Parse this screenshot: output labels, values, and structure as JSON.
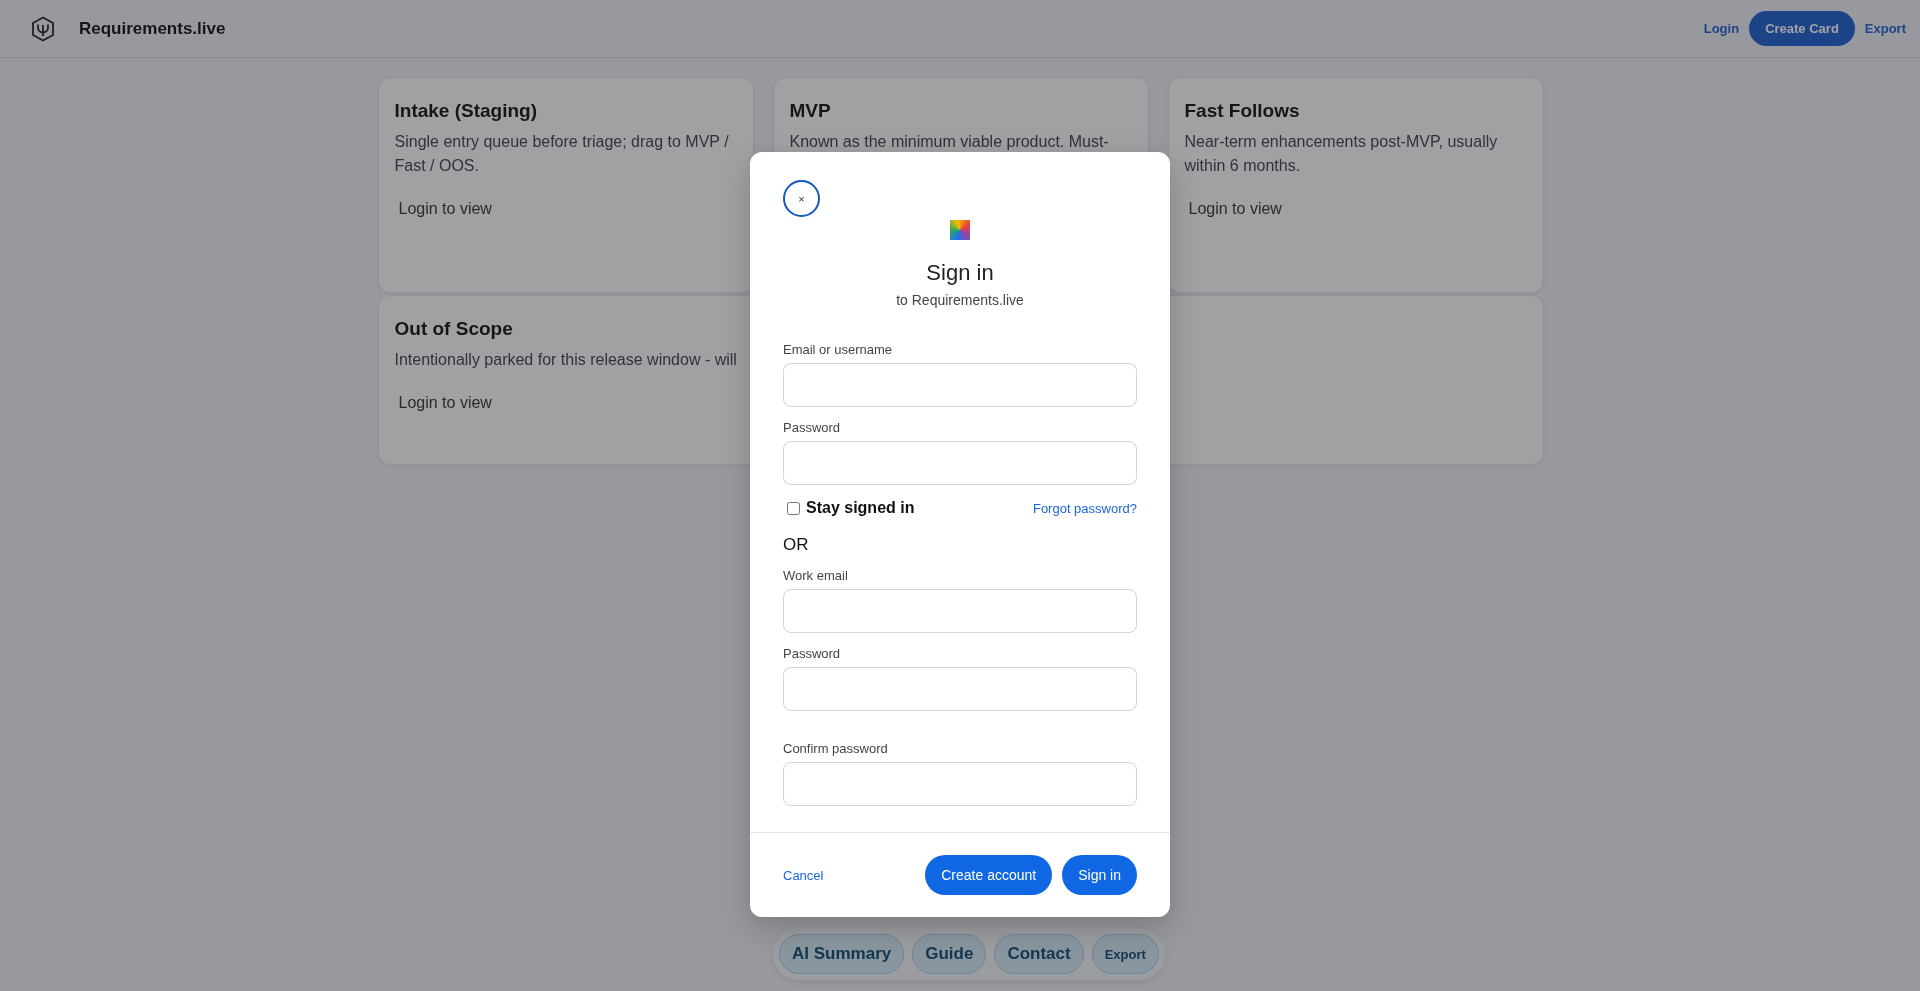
{
  "header": {
    "brand": "Requirements.live",
    "nav": [
      {
        "kind": "link",
        "label": "Login"
      },
      {
        "kind": "button",
        "label": "Create Card"
      },
      {
        "kind": "link",
        "label": "Export"
      }
    ]
  },
  "cards": [
    {
      "title": "Intake (Staging)",
      "description": "Single entry queue before triage; drag to MVP / Fast / OOS.",
      "action": "Login to view"
    },
    {
      "title": "MVP",
      "description": "Known as the minimum viable product. Must-"
    },
    {
      "title": "Fast Follows",
      "description": "Near-term enhancements post-MVP, usually within 6 months.",
      "action": "Login to view"
    },
    {
      "title": "Out of Scope",
      "description": "Intentionally parked for this release window - will",
      "action": "Login to view"
    }
  ],
  "modal": {
    "close": "×",
    "title": "Sign in",
    "subtitle": "to Requirements.live",
    "fields": [
      {
        "label": "Email or username"
      },
      {
        "label": "Password"
      }
    ],
    "remember": {
      "label": "Stay signed in",
      "checked": false
    },
    "forgot": "Forgot password?",
    "separator": "OR",
    "signup_fields": [
      {
        "label": "Work email"
      },
      {
        "label": "Password"
      },
      {
        "label": "Confirm password"
      }
    ],
    "cancel": "Cancel",
    "buttons": [
      "Create account",
      "Sign in"
    ]
  },
  "dock": [
    {
      "label": "AI Summary",
      "kind": "large"
    },
    {
      "label": "Guide",
      "kind": "large"
    },
    {
      "label": "Contact",
      "kind": "large"
    },
    {
      "label": "Export",
      "kind": "small"
    }
  ]
}
